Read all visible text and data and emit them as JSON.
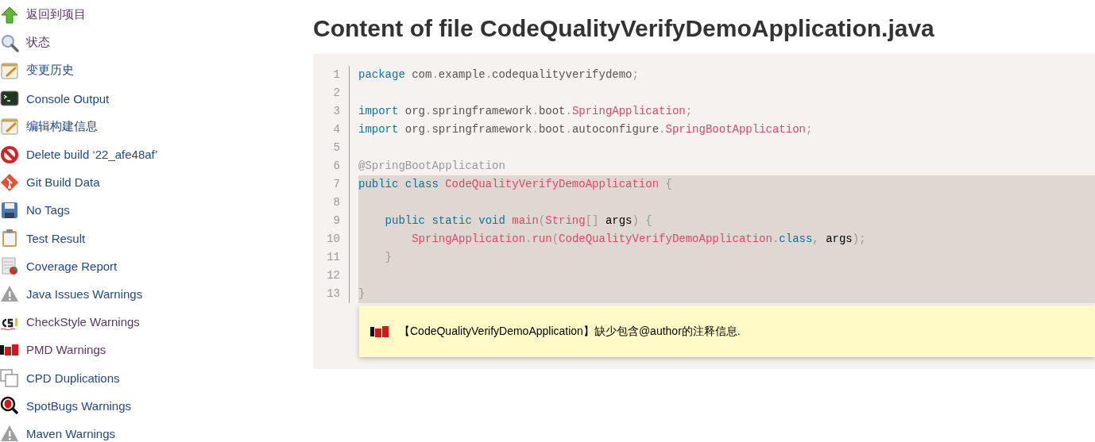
{
  "sidebar": {
    "items": [
      {
        "label": "返回到项目",
        "kind": "up",
        "visited": true
      },
      {
        "label": "状态",
        "kind": "search",
        "visited": true
      },
      {
        "label": "变更历史",
        "kind": "notepad",
        "visited": false
      },
      {
        "label": "Console Output",
        "kind": "terminal",
        "visited": false
      },
      {
        "label": "编辑构建信息",
        "kind": "notepad",
        "visited": false
      },
      {
        "label": "Delete build ‘22_afe48af’",
        "kind": "nosign",
        "visited": false
      },
      {
        "label": "Git Build Data",
        "kind": "git",
        "visited": false
      },
      {
        "label": "No Tags",
        "kind": "floppy",
        "visited": false
      },
      {
        "label": "Test Result",
        "kind": "clipboard",
        "visited": false
      },
      {
        "label": "Coverage Report",
        "kind": "report",
        "visited": false
      },
      {
        "label": "Java Issues Warnings",
        "kind": "warning",
        "visited": false
      },
      {
        "label": "CheckStyle Warnings",
        "kind": "cs",
        "visited": true
      },
      {
        "label": "PMD Warnings",
        "kind": "pmd",
        "visited": true
      },
      {
        "label": "CPD Duplications",
        "kind": "copies",
        "visited": false
      },
      {
        "label": "SpotBugs Warnings",
        "kind": "bug",
        "visited": false
      },
      {
        "label": "Maven Warnings",
        "kind": "warning",
        "visited": false
      }
    ]
  },
  "main": {
    "title": "Content of file CodeQualityVerifyDemoApplication.java",
    "code": {
      "lines": [
        {
          "number": "1",
          "highlighted": false,
          "tokens": [
            {
              "text": "package ",
              "kind": "keyword"
            },
            {
              "text": "com",
              "kind": "plain"
            },
            {
              "text": ".",
              "kind": "punct"
            },
            {
              "text": "example",
              "kind": "plain"
            },
            {
              "text": ".",
              "kind": "punct"
            },
            {
              "text": "codequalityverifydemo",
              "kind": "plain"
            },
            {
              "text": ";",
              "kind": "punct"
            }
          ]
        },
        {
          "number": "2",
          "highlighted": false
        },
        {
          "number": "3",
          "highlighted": false,
          "tokens": [
            {
              "text": "import ",
              "kind": "keyword"
            },
            {
              "text": "org",
              "kind": "plain"
            },
            {
              "text": ".",
              "kind": "punct"
            },
            {
              "text": "springframework",
              "kind": "plain"
            },
            {
              "text": ".",
              "kind": "punct"
            },
            {
              "text": "boot",
              "kind": "plain"
            },
            {
              "text": ".",
              "kind": "punct"
            },
            {
              "text": "SpringApplication",
              "kind": "name"
            },
            {
              "text": ";",
              "kind": "punct"
            }
          ]
        },
        {
          "number": "4",
          "highlighted": false,
          "tokens": [
            {
              "text": "import ",
              "kind": "keyword"
            },
            {
              "text": "org",
              "kind": "plain"
            },
            {
              "text": ".",
              "kind": "punct"
            },
            {
              "text": "springframework",
              "kind": "plain"
            },
            {
              "text": ".",
              "kind": "punct"
            },
            {
              "text": "boot",
              "kind": "plain"
            },
            {
              "text": ".",
              "kind": "punct"
            },
            {
              "text": "autoconfigure",
              "kind": "plain"
            },
            {
              "text": ".",
              "kind": "punct"
            },
            {
              "text": "SpringBootApplication",
              "kind": "name"
            },
            {
              "text": ";",
              "kind": "punct"
            }
          ]
        },
        {
          "number": "5",
          "highlighted": false
        },
        {
          "number": "6",
          "highlighted": false,
          "tokens": [
            {
              "text": "@SpringBootApplication",
              "kind": "annotation"
            }
          ]
        },
        {
          "number": "7",
          "highlighted": true,
          "tokens": [
            {
              "text": "public class ",
              "kind": "keyword"
            },
            {
              "text": "CodeQualityVerifyDemoApplication",
              "kind": "name"
            },
            {
              "text": " {",
              "kind": "punct"
            }
          ]
        },
        {
          "number": "8",
          "highlighted": true
        },
        {
          "number": "9",
          "highlighted": true,
          "tokens": [
            {
              "text": "    public static void ",
              "kind": "keyword"
            },
            {
              "text": "main",
              "kind": "name"
            },
            {
              "text": "(",
              "kind": "punct"
            },
            {
              "text": "String",
              "kind": "name"
            },
            {
              "text": "[]",
              "kind": "punct"
            },
            {
              "text": " args",
              "kind": "variable"
            },
            {
              "text": ") {",
              "kind": "punct"
            }
          ]
        },
        {
          "number": "10",
          "highlighted": true,
          "tokens": [
            {
              "text": "        SpringApplication",
              "kind": "name"
            },
            {
              "text": ".",
              "kind": "punct"
            },
            {
              "text": "run",
              "kind": "name"
            },
            {
              "text": "(",
              "kind": "punct"
            },
            {
              "text": "CodeQualityVerifyDemoApplication",
              "kind": "name"
            },
            {
              "text": ".",
              "kind": "punct"
            },
            {
              "text": "class",
              "kind": "keyword"
            },
            {
              "text": ",",
              "kind": "punct"
            },
            {
              "text": " args",
              "kind": "variable"
            },
            {
              "text": ");",
              "kind": "punct"
            }
          ]
        },
        {
          "number": "11",
          "highlighted": true,
          "tokens": [
            {
              "text": "    }",
              "kind": "punct"
            }
          ]
        },
        {
          "number": "12",
          "highlighted": true
        },
        {
          "number": "13",
          "highlighted": true,
          "tokens": [
            {
              "text": "}",
              "kind": "punct"
            }
          ]
        }
      ]
    },
    "warning": {
      "message": "【CodeQualityVerifyDemoApplication】缺少包含@author的注释信息."
    }
  }
}
